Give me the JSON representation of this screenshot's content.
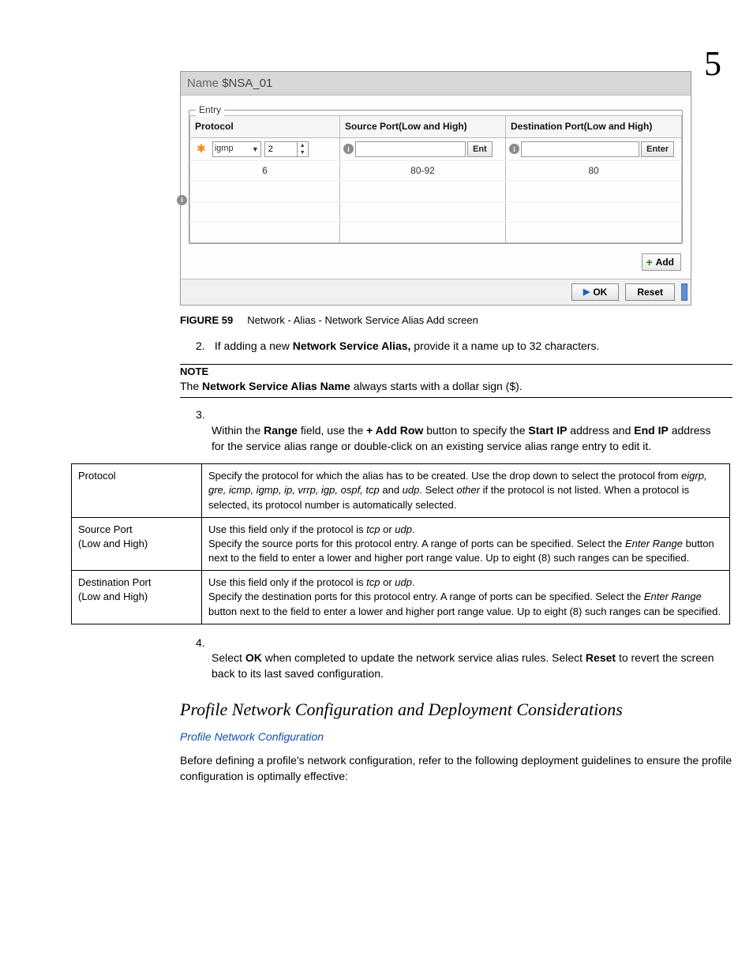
{
  "chapter": "5",
  "screenshot": {
    "name_label": "Name",
    "name_value": "$NSA_01",
    "entry_label": "Entry",
    "headers": {
      "protocol": "Protocol",
      "source": "Source Port(Low and High)",
      "dest": "Destination Port(Low and High)"
    },
    "row1": {
      "proto_select": "igmp",
      "proto_num": "2",
      "src_placeholder": "",
      "src_btn": "Ent",
      "dst_placeholder": "",
      "dst_btn": "Enter"
    },
    "row2": {
      "proto": "6",
      "src": "80-92",
      "dst": "80"
    },
    "add_label": "Add",
    "ok_label": "OK",
    "reset_label": "Reset"
  },
  "figure": {
    "label": "FIGURE 59",
    "text": "Network - Alias - Network Service Alias Add screen"
  },
  "step2": {
    "num": "2.",
    "pre": "If adding a new ",
    "bold": "Network Service Alias,",
    "post": " provide it a name up to 32 characters."
  },
  "note": {
    "label": "NOTE",
    "pre": "The ",
    "bold": "Network Service Alias Name",
    "post": " always starts with a dollar sign ($)."
  },
  "step3": {
    "num": "3.",
    "p1a": "Within the ",
    "p1b": "Range",
    "p1c": " field, use the ",
    "p1d": "+ Add Row",
    "p1e": " button to specify the ",
    "p1f": "Start IP",
    "p1g": " address and ",
    "p1h": "End IP",
    "p1i": " address for the service alias range or double-click on an existing service alias range entry to edit it."
  },
  "desc_table": {
    "r1k": "Protocol",
    "r1v_a": "Specify the protocol for which the alias has to be created. Use the drop down to select the protocol from ",
    "r1v_i": "eigrp, gre, icmp, igmp, ip, vrrp, igp, ospf, tcp",
    "r1v_b": " and ",
    "r1v_i2": "udp",
    "r1v_c": ". Select ",
    "r1v_i3": "other",
    "r1v_d": " if the protocol is not listed. When a protocol is selected, its protocol number is automatically selected.",
    "r2k1": "Source Port",
    "r2k2": "(Low and High)",
    "r2v_a": "Use this field only if the protocol is ",
    "r2v_i1": "tcp",
    "r2v_b": " or ",
    "r2v_i2": "udp",
    "r2v_c": ".",
    "r2v_d": "Specify the source ports for this protocol entry. A range of ports can be specified. Select the ",
    "r2v_i3": "Enter Range",
    "r2v_e": " button next to the field to enter a lower and higher port range value. Up to eight (8) such ranges can be specified.",
    "r3k1": "Destination Port",
    "r3k2": "(Low and High)",
    "r3v_a": "Use this field only if the protocol is ",
    "r3v_i1": "tcp",
    "r3v_b": " or ",
    "r3v_i2": "udp",
    "r3v_c": ".",
    "r3v_d": "Specify the destination ports for this protocol entry. A range of ports can be specified. Select the ",
    "r3v_i3": "Enter Range",
    "r3v_e": " button next to the field to enter a lower and higher port range value. Up to eight (8) such ranges can be specified."
  },
  "step4": {
    "num": "4.",
    "a": "Select ",
    "b1": "OK",
    "c": " when completed to update the network service alias rules. Select ",
    "b2": "Reset",
    "d": " to revert the screen back to its last saved configuration."
  },
  "subhead": "Profile Network Configuration and Deployment Considerations",
  "bluelink": "Profile Network Configuration",
  "para1": "Before defining a profile's network configuration, refer to the following deployment guidelines to ensure the profile configuration is optimally effective:"
}
